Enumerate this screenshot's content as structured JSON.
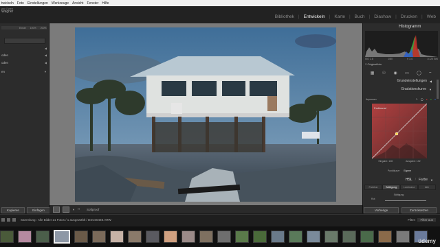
{
  "menubar": {
    "items": [
      "twickeln",
      "Foto",
      "Einstellungen",
      "Werkzeuge",
      "Ansicht",
      "Fenster",
      "Hilfe"
    ]
  },
  "header": {
    "identity_line1": "om Owen",
    "identity_line2": "Wagner",
    "modules": [
      "Bibliothek",
      "Entwickeln",
      "Karte",
      "Buch",
      "Diashow",
      "Drucken",
      "Web"
    ],
    "active_module": "Entwickeln"
  },
  "left_panel": {
    "presets_tabs": [
      "Einste",
      "100%",
      "200%"
    ],
    "section1": "",
    "section2": "oden",
    "section3": "en",
    "copy_button": "Kopieren",
    "paste_button": "Einfügen"
  },
  "toolbar": {
    "softproof_label": "Softproof"
  },
  "right_panel": {
    "histogram_title": "Histogramm",
    "histogram_info": [
      "ISO 2.8",
      "1/80",
      "f/ 3.4",
      "1/125 Sek"
    ],
    "original_photo": "Originalfoto",
    "sections": {
      "basic": "Grundeinstellungen",
      "tone_curve": "Gradationskurve"
    },
    "curve_toolbar_label": "Anpassen",
    "curve_channel_label": "Farbkanal",
    "curve_value_labels": [
      "Eingabe: 128",
      "Ausgabe: 132"
    ],
    "curve_mode_labels": [
      "Punktkurve",
      "Eigene"
    ],
    "hsl_row": [
      "HSL",
      "Farbe"
    ],
    "hsl_tabs": [
      "Farbton",
      "Sättigung",
      "Luminanz",
      "Alle"
    ],
    "hsl_active_tab": "Sättigung",
    "hsl_slider_label": "Sättigung",
    "hsl_sub": "Rot",
    "prev_button": "Vorherige",
    "reset_button": "Zurücksetzen"
  },
  "filmstrip": {
    "path_text": "Sammlung : Alle Bilder  21 Fotos / 1 ausgewählt / DSC00488.ARW",
    "filter_label": "Filter:",
    "filter_value": "Filter aus",
    "thumb_count": 24,
    "selected_index": 3,
    "thumb_colors": [
      "#4a5a3a",
      "#b58aa0",
      "#4b5e4a",
      "#8e98a6",
      "#6a5a48",
      "#7a6a5a",
      "#c6b2a6",
      "#8a7a6a",
      "#5a5a60",
      "#d0a080",
      "#9a8a88",
      "#7e7060",
      "#6e6e6e",
      "#5a7a4a",
      "#4a6a3a",
      "#6a7a8a",
      "#5a7a5a",
      "#7a8a9a",
      "#6a7a6a",
      "#5a6a5a",
      "#4a6a4a",
      "#8a6a4a",
      "#7a7a7a",
      "#6a7a9a"
    ]
  },
  "brand": "üdemy"
}
